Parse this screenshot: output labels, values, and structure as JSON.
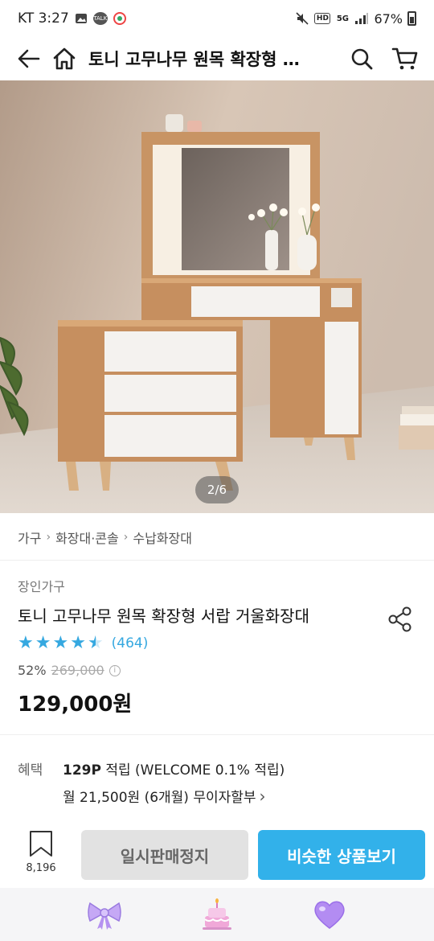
{
  "status": {
    "carrier_time": "KT 3:27",
    "battery": "67%",
    "network": "5G"
  },
  "header": {
    "title": "토니 고무나무 원목 확장형 …"
  },
  "image": {
    "counter": "2/6"
  },
  "breadcrumb": [
    "가구",
    "화장대·콘솔",
    "수납화장대"
  ],
  "product": {
    "brand": "장인가구",
    "name": "토니 고무나무 원목 확장형 서랍 거울화장대",
    "rating_value": 4.5,
    "review_count": "(464)",
    "discount": "52%",
    "original_price": "269,000",
    "sale_price": "129,000원"
  },
  "benefit": {
    "label": "혜택",
    "points": "129P",
    "points_text": " 적립 (WELCOME 0.1% 적립)",
    "installment": "월 21,500원 (6개월) 무이자할부"
  },
  "actions": {
    "bookmark_count": "8,196",
    "sold_out_label": "일시판매정지",
    "similar_label": "비슷한 상품보기"
  },
  "colors": {
    "accent": "#32b1ea",
    "star": "#35a8e0"
  },
  "tabs": [
    "ribbon-icon",
    "cake-icon",
    "heart-icon"
  ]
}
